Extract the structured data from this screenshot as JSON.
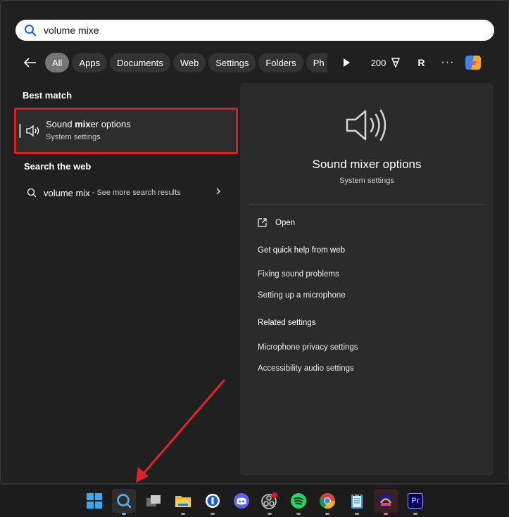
{
  "search": {
    "value": "volume mixe",
    "placeholder": ""
  },
  "filters": {
    "back_label": "←",
    "tabs": [
      {
        "label": "All",
        "active": true
      },
      {
        "label": "Apps"
      },
      {
        "label": "Documents"
      },
      {
        "label": "Web"
      },
      {
        "label": "Settings"
      },
      {
        "label": "Folders"
      },
      {
        "label": "Ph"
      }
    ],
    "points": "200",
    "avatar_initial": "R",
    "more": "···"
  },
  "best_match": {
    "heading": "Best match",
    "title_pre": "Sound ",
    "title_bold": "mix",
    "title_post": "er options",
    "subtitle": "System settings"
  },
  "web": {
    "heading": "Search the web",
    "query": "volume mix",
    "suffix": " - See more search results"
  },
  "preview": {
    "title": "Sound mixer options",
    "subtitle": "System settings",
    "open_label": "Open",
    "quick_help_heading": "Get quick help from web",
    "quick_help": [
      "Fixing sound problems",
      "Setting up a microphone"
    ],
    "related_heading": "Related settings",
    "related": [
      "Microphone privacy settings",
      "Accessibility audio settings"
    ]
  },
  "colors": {
    "highlight_border": "#d32224",
    "arrow": "#e02424",
    "background": "#202020",
    "panel": "#2b2b2b"
  },
  "taskbar": {
    "icons": [
      "windows-start-icon",
      "search-icon",
      "task-view-icon",
      "file-explorer-icon",
      "1password-icon",
      "discord-icon",
      "obs-icon",
      "spotify-icon",
      "chrome-icon",
      "notepad-icon",
      "audio-app-icon",
      "premiere-pro-icon"
    ],
    "premiere_label": "Pr"
  }
}
